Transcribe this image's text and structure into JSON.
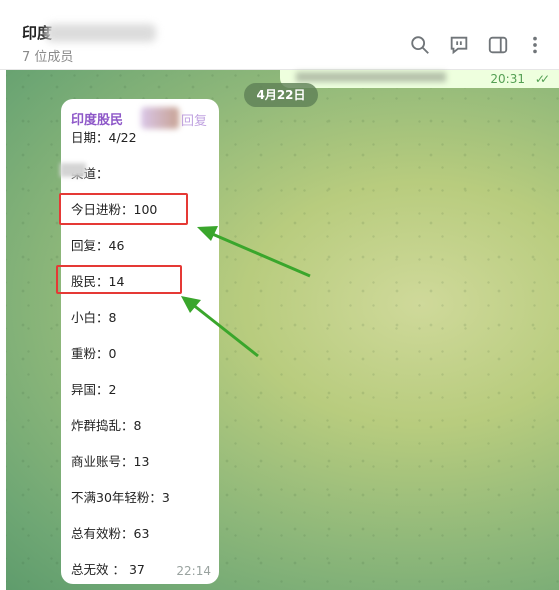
{
  "header": {
    "chat_title": "印度",
    "member_count": "7 位成员",
    "icons": [
      "search-icon",
      "chat-icon",
      "sidebar-icon",
      "more-icon"
    ]
  },
  "top_message": {
    "time": "20:31"
  },
  "date_separator": "4月22日",
  "message": {
    "sender": "印度股民",
    "reply_label": "回复",
    "lines": [
      "日期：4/22",
      "渠道：",
      "今日进粉：100",
      "回复：46",
      "股民：14",
      "小白：8",
      "重粉：0",
      "异国：2",
      "炸群捣乱：8",
      "商业账号：13",
      "不满30年轻粉：3",
      "总有效粉：63",
      "总无效 ： 37"
    ],
    "time": "22:14"
  },
  "colors": {
    "highlight": "#e53935",
    "arrow": "#3aa62c",
    "sender": "#8e58c8"
  }
}
